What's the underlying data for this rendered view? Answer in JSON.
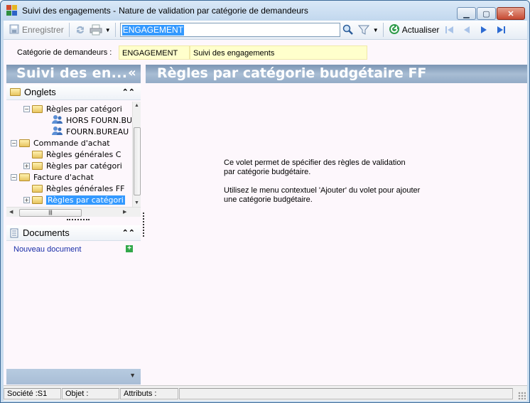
{
  "window": {
    "title": "Suivi des engagements -",
    "subtitle": "Nature de validation par catégorie de demandeurs",
    "minimize": "▁",
    "maximize": "▢",
    "close": "✕"
  },
  "toolbar": {
    "save_label": "Enregistrer",
    "search_value": "ENGAGEMENT",
    "refresh_label": "Actualiser"
  },
  "header": {
    "label": "Catégorie de demandeurs :",
    "code": "ENGAGEMENT",
    "description": "Suivi des engagements"
  },
  "left_panel": {
    "title": "Suivi des en...",
    "collapse": "«",
    "onglets_title": "Onglets",
    "tree": [
      {
        "level": 1,
        "expander": "−",
        "icon": "folder",
        "label": "Règles par catégori",
        "selected": false
      },
      {
        "level": 2,
        "expander": "",
        "icon": "users",
        "label": "HORS FOURN.BU",
        "selected": false
      },
      {
        "level": 2,
        "expander": "",
        "icon": "users",
        "label": "FOURN.BUREAU",
        "selected": false
      },
      {
        "level": 0,
        "expander": "−",
        "icon": "folder",
        "label": "Commande d'achat",
        "selected": false
      },
      {
        "level": 1,
        "expander": "",
        "icon": "folder",
        "label": "Règles générales C",
        "selected": false
      },
      {
        "level": 1,
        "expander": "+",
        "icon": "folder",
        "label": "Règles par catégori",
        "selected": false
      },
      {
        "level": 0,
        "expander": "−",
        "icon": "folder",
        "label": "Facture d'achat",
        "selected": false
      },
      {
        "level": 1,
        "expander": "",
        "icon": "folder",
        "label": "Règles générales FF",
        "selected": false
      },
      {
        "level": 1,
        "expander": "+",
        "icon": "folder-open",
        "label": "Règles par catégori",
        "selected": true
      }
    ],
    "documents_title": "Documents",
    "new_document": "Nouveau document"
  },
  "right_panel": {
    "title": "Règles par catégorie budgétaire FF",
    "info_line1": "Ce volet permet de spécifier des règles de validation",
    "info_line2": "par catégorie budgétaire.",
    "info_line3": "Utilisez le menu contextuel 'Ajouter' du volet pour ajouter",
    "info_line4": "une catégorie budgétaire."
  },
  "status": {
    "societe": "Société :S1",
    "objet": "Objet :",
    "attributs": "Attributs :"
  },
  "colors": {
    "panel_header": "#93abc6",
    "selection": "#3399ff",
    "field_background": "#ffffcc"
  }
}
